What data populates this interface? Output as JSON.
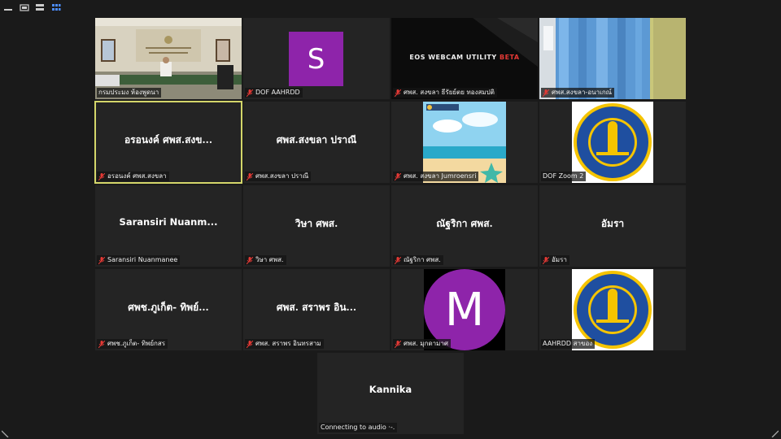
{
  "toolbar": {
    "icons": [
      "minimize-icon",
      "speaker-view-icon",
      "gallery-strip-icon",
      "gallery-view-icon"
    ]
  },
  "tiles": [
    {
      "id": "t1",
      "label": "กรมประมง ห้องพูดนา",
      "kind": "room-video"
    },
    {
      "id": "t2",
      "label": "DOF AAHRDD",
      "kind": "avatar-s",
      "avatar": "S"
    },
    {
      "id": "t3",
      "label": "ศพส. สงขลา ธีรัยย์ตย ทองสมปติ",
      "kind": "eos-screen",
      "eos_text": "EOS WEBCAM UTILITY",
      "eos_beta": "BETA"
    },
    {
      "id": "t4",
      "label": "ศพส.สงขลา-อนาเกณ์",
      "kind": "curtain-video"
    },
    {
      "id": "t5",
      "name": "อรอนงค์ ศพส.สงข...",
      "label": "อรอนงค์ ศพส.สงขลา",
      "kind": "name"
    },
    {
      "id": "t6",
      "name": "ศพส.สงขลา ปราณี",
      "label": "ศพส.สงขลา ปราณี",
      "kind": "name"
    },
    {
      "id": "t7",
      "label": "ศพส. สงขลา Jumroensri",
      "kind": "beach-image"
    },
    {
      "id": "t8",
      "label": "DOF Zoom 2",
      "kind": "seal"
    },
    {
      "id": "t9",
      "name": "Saransiri  Nuanm...",
      "label": "Saransiri Nuanmanee",
      "kind": "name"
    },
    {
      "id": "t10",
      "name": "วิษา ศพส.",
      "label": "วิษา ศพส.",
      "kind": "name"
    },
    {
      "id": "t11",
      "name": "ณัฐริกา ศพส.",
      "label": "ณัฐริกา ศพส.",
      "kind": "name"
    },
    {
      "id": "t12",
      "name": "อัมรา",
      "label": "อัมรา",
      "kind": "name"
    },
    {
      "id": "t13",
      "name": "ศพช.ภูเก็ต- ทิพย์...",
      "label": "ศพช.ภูเก็ต- ทิพย์กสร",
      "kind": "name"
    },
    {
      "id": "t14",
      "name": "ศพส. สราพร  อิน...",
      "label": "ศพส. สราพร  อินทรสาม",
      "kind": "name"
    },
    {
      "id": "t15",
      "label": "ศพส. มุกดามาศ",
      "kind": "avatar-m",
      "avatar": "M"
    },
    {
      "id": "t16",
      "label": "AAHRDD สาของ",
      "kind": "seal"
    },
    {
      "id": "t17",
      "name": "Kannika",
      "label": "Connecting to audio",
      "kind": "name-connecting"
    }
  ],
  "colors": {
    "background": "#1a1a1a",
    "tile": "#242424",
    "active_border": "#d4d66a",
    "avatar_purple": "#8e24aa",
    "muted_red": "#e53935"
  }
}
